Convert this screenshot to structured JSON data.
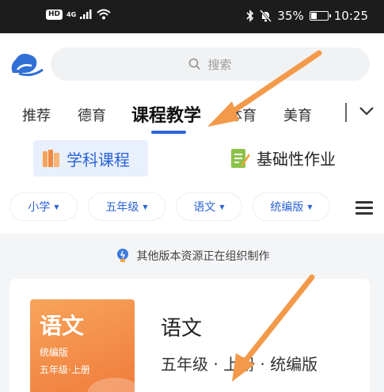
{
  "status_bar": {
    "hd_label": "HD",
    "signal_label": "4G",
    "battery": "35%",
    "battery_level": 0.35,
    "time": "10:25"
  },
  "search": {
    "placeholder": "搜索"
  },
  "tabs": [
    {
      "label": "推荐",
      "active": false
    },
    {
      "label": "德育",
      "active": false
    },
    {
      "label": "课程教学",
      "active": true
    },
    {
      "label": "体育",
      "active": false
    },
    {
      "label": "美育",
      "active": false
    }
  ],
  "subtabs": {
    "subject_courses": "学科课程",
    "basic_homework": "基础性作业"
  },
  "filters": [
    {
      "label": "小学"
    },
    {
      "label": "五年级"
    },
    {
      "label": "语文"
    },
    {
      "label": "统编版"
    }
  ],
  "notice": "其他版本资源正在组织制作",
  "book": {
    "cover_title": "语文",
    "cover_edition": "统编版",
    "cover_grade": "五年级·上册",
    "title": "语文",
    "meta": "五年级 · 上册 · 统编版"
  },
  "colors": {
    "accent": "#2b63d9",
    "annotation_arrow": "#f39a4a",
    "cover_orange": "#f07a3a"
  }
}
